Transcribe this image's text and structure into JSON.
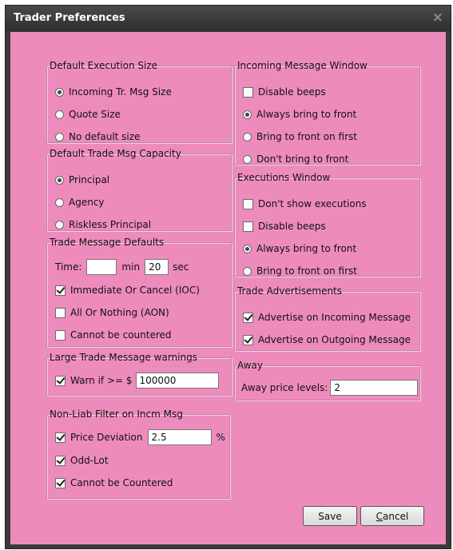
{
  "window": {
    "title": "Trader Preferences",
    "close_glyph": "×"
  },
  "default_execution_size": {
    "legend": "Default Execution Size",
    "options": [
      {
        "label": "Incoming Tr. Msg Size",
        "selected": true
      },
      {
        "label": "Quote Size",
        "selected": false
      },
      {
        "label": "No default size",
        "selected": false
      }
    ]
  },
  "default_trade_msg_capacity": {
    "legend": "Default Trade Msg Capacity",
    "options": [
      {
        "label": "Principal",
        "selected": true
      },
      {
        "label": "Agency",
        "selected": false
      },
      {
        "label": "Riskless Principal",
        "selected": false
      }
    ]
  },
  "trade_message_defaults": {
    "legend": "Trade Message Defaults",
    "time_label": "Time:",
    "min_value": "",
    "min_label": "min",
    "sec_value": "20",
    "sec_label": "sec",
    "checks": [
      {
        "label": "Immediate Or Cancel (IOC)",
        "checked": true
      },
      {
        "label": "All Or Nothing (AON)",
        "checked": false
      },
      {
        "label": "Cannot be countered",
        "checked": false
      }
    ]
  },
  "large_trade_warnings": {
    "legend": "Large Trade Message warnings",
    "warn_label": "Warn if >= $",
    "warn_checked": true,
    "warn_value": "100000"
  },
  "non_liab_filter": {
    "legend": "Non-Liab Filter on Incm Msg",
    "price_deviation_label": "Price Deviation",
    "price_deviation_checked": true,
    "price_deviation_value": "2.5",
    "percent": "%",
    "odd_lot_label": "Odd-Lot",
    "odd_lot_checked": true,
    "cannot_countered_label": "Cannot be Countered",
    "cannot_countered_checked": true
  },
  "incoming_message_window": {
    "legend": "Incoming Message Window",
    "disable_beeps": {
      "label": "Disable beeps",
      "checked": false
    },
    "options": [
      {
        "label": "Always bring to front",
        "selected": true
      },
      {
        "label": "Bring to front on first",
        "selected": false
      },
      {
        "label": "Don't bring to front",
        "selected": false
      }
    ]
  },
  "executions_window": {
    "legend": "Executions Window",
    "checks": [
      {
        "label": "Don't show executions",
        "checked": false
      },
      {
        "label": "Disable beeps",
        "checked": false
      }
    ],
    "options": [
      {
        "label": "Always bring to front",
        "selected": true
      },
      {
        "label": "Bring to front on first",
        "selected": false
      }
    ]
  },
  "trade_advertisements": {
    "legend": "Trade Advertisements",
    "checks": [
      {
        "label": "Advertise on Incoming Message",
        "checked": true
      },
      {
        "label": "Advertise on Outgoing Message",
        "checked": true
      }
    ]
  },
  "away": {
    "legend": "Away",
    "label": "Away price levels:",
    "value": "2"
  },
  "buttons": {
    "save": "Save",
    "cancel": "Cancel"
  }
}
